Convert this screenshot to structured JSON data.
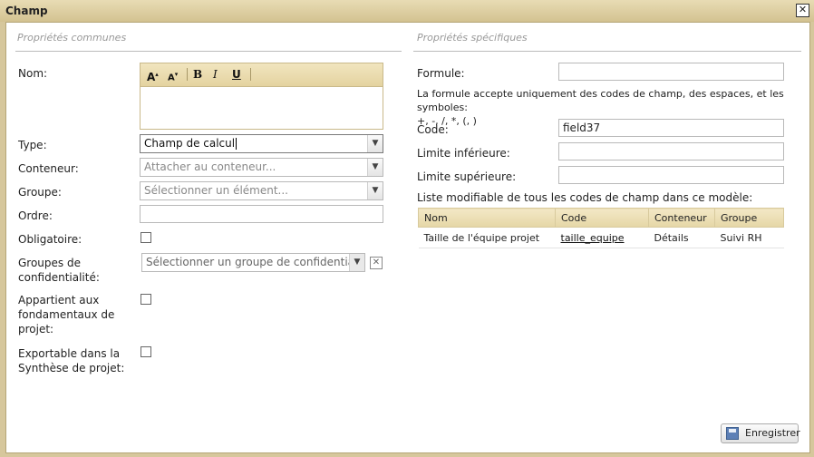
{
  "window": {
    "title": "Champ",
    "close_glyph": "✕"
  },
  "left": {
    "section_title": "Propriétés communes",
    "nom": {
      "label": "Nom:",
      "toolbar": {
        "grow": "A",
        "shrink": "A",
        "bold": "B",
        "italic": "I",
        "underline": "U"
      }
    },
    "type": {
      "label": "Type:",
      "value": "Champ de calcul"
    },
    "conteneur": {
      "label": "Conteneur:",
      "placeholder": "Attacher au conteneur..."
    },
    "groupe": {
      "label": "Groupe:",
      "placeholder": "Sélectionner un élément..."
    },
    "ordre": {
      "label": "Ordre:",
      "value": ""
    },
    "obligatoire": {
      "label": "Obligatoire:",
      "checked": false
    },
    "confidentialite": {
      "label_line1": "Groupes de",
      "label_line2": "confidentialité:",
      "placeholder": "Sélectionner un groupe de confidentialité"
    },
    "fondamentaux": {
      "label_line1": "Appartient aux",
      "label_line2": "fondamentaux de",
      "label_line3": "projet:",
      "checked": false
    },
    "exportable": {
      "label_line1": "Exportable dans la",
      "label_line2": "Synthèse de projet:",
      "checked": false
    }
  },
  "right": {
    "section_title": "Propriétés spécifiques",
    "formule": {
      "label": "Formule:",
      "value": ""
    },
    "hint_line1": "La formule accepte uniquement des codes de champ, des espaces, et les symboles:",
    "hint_line2": "+, -, /, *, (, )",
    "code": {
      "label": "Code:",
      "value": "field37"
    },
    "limite_inf": {
      "label": "Limite inférieure:",
      "value": ""
    },
    "limite_sup": {
      "label": "Limite supérieure:",
      "value": ""
    },
    "list_title": "Liste modifiable de tous les codes de champ dans ce modèle:",
    "table": {
      "headers": [
        "Nom",
        "Code",
        "Conteneur",
        "Groupe"
      ],
      "rows": [
        {
          "nom": "Taille de l'équipe projet",
          "code": "taille_equipe",
          "conteneur": "Détails",
          "groupe": "Suivi RH"
        }
      ]
    }
  },
  "footer": {
    "save_label": "Enregistrer"
  },
  "colors": {
    "frame": "#d6c79c",
    "toolbar": "#e8d9a8",
    "header": "#ece0b8"
  }
}
